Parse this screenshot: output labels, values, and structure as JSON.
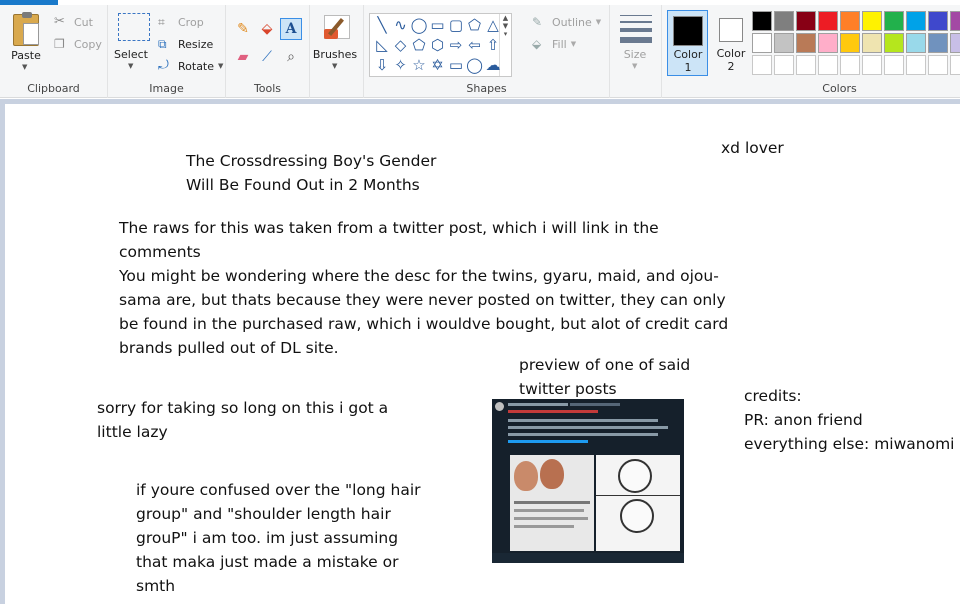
{
  "ribbon": {
    "clipboard": {
      "paste": "Paste",
      "cut": "Cut",
      "copy": "Copy",
      "label": "Clipboard"
    },
    "image": {
      "select": "Select",
      "crop": "Crop",
      "resize": "Resize",
      "rotate": "Rotate",
      "label": "Image"
    },
    "tools": {
      "label": "Tools",
      "icons": [
        "pencil-icon",
        "fill-icon",
        "text-icon",
        "eraser-icon",
        "color-picker-icon",
        "magnifier-icon"
      ]
    },
    "brushes": {
      "label": "Brushes"
    },
    "shapes": {
      "label": "Shapes",
      "outline": "Outline",
      "fill": "Fill",
      "glyphs": [
        "╲",
        "∿",
        "◯",
        "▭",
        "▢",
        "⬠",
        "△",
        "◺",
        "◇",
        "⬠",
        "⬡",
        "⇨",
        "⇦",
        "⇧",
        "⇩",
        "✧",
        "☆",
        "✡",
        "▭",
        "◯",
        "☁"
      ]
    },
    "size": {
      "label": "Size"
    },
    "colors": {
      "color1_label": "Color\n1",
      "color2_label": "Color\n2",
      "color1": "#000000",
      "color2": "#ffffff",
      "label": "Colors",
      "palette_row1": [
        "#000000",
        "#7f7f7f",
        "#880015",
        "#ed1c24",
        "#ff7f27",
        "#fff200",
        "#22b14c",
        "#00a2e8",
        "#3f48cc",
        "#a349a4"
      ],
      "palette_row2": [
        "#ffffff",
        "#c3c3c3",
        "#b97a57",
        "#ffaec9",
        "#ffc90e",
        "#efe4b0",
        "#b5e61d",
        "#99d9ea",
        "#7092be",
        "#c8bfe7"
      ],
      "palette_row3": [
        "#ffffff",
        "#ffffff",
        "#ffffff",
        "#ffffff",
        "#ffffff",
        "#ffffff",
        "#ffffff",
        "#ffffff",
        "#ffffff",
        "#ffffff"
      ]
    }
  },
  "canvas": {
    "title": "The Crossdressing Boy's Gender\nWill Be Found Out in 2 Months",
    "signature": "xd lover",
    "description": "The raws for this was taken from a twitter post, which i will link in the\ncomments\nYou might be wondering where the desc for the twins, gyaru, maid, and ojou-\nsama are, but thats because they were never posted on twitter, they can only\nbe found in the purchased raw, which i wouldve bought, but alot of credit card\nbrands pulled out of DL site.",
    "preview_caption": "preview of one of said\ntwitter posts",
    "apology": "sorry for taking so long on this i got a\nlittle lazy",
    "credits": "credits:\nPR: anon friend\neverything else: miwanomi",
    "confusion_note": "if youre confused over the \"long hair\ngroup\" and \"shoulder length hair\ngrouP\" i am too. im just assuming\nthat maka just made a mistake or\nsmth"
  }
}
